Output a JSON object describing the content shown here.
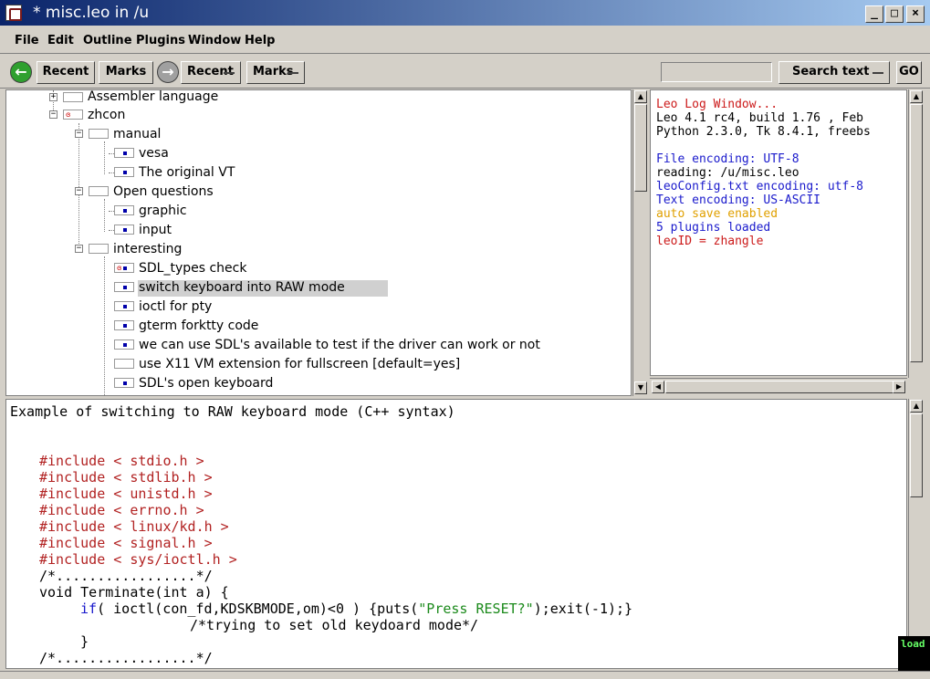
{
  "window": {
    "title": "* misc.leo in /u"
  },
  "menu": [
    "File",
    "Edit",
    "Outline",
    "Plugins",
    "Window",
    "Help"
  ],
  "toolbar": {
    "recent": "Recent",
    "marks": "Marks",
    "recent_menu": "Recent",
    "marks_menu": "Marks",
    "search_value": "",
    "search_text": "Search text",
    "go": "GO"
  },
  "outline": [
    {
      "label": "Assembler language"
    },
    {
      "label": "zhcon"
    },
    {
      "label": "manual"
    },
    {
      "label": "vesa"
    },
    {
      "label": "The original VT"
    },
    {
      "label": "Open questions"
    },
    {
      "label": "graphic"
    },
    {
      "label": "input"
    },
    {
      "label": "interesting"
    },
    {
      "label": "SDL_types check"
    },
    {
      "label": "switch keyboard into RAW mode"
    },
    {
      "label": "ioctl for pty"
    },
    {
      "label": "gterm forktty code"
    },
    {
      "label": "we can use SDL's available to test if the driver can work or not"
    },
    {
      "label": "use X11 VM extension for fullscreen [default=yes]"
    },
    {
      "label": "SDL's open keyboard"
    }
  ],
  "log": [
    {
      "text": "Leo Log Window...",
      "color": "#cc1a1a"
    },
    {
      "text": "Leo 4.1 rc4, build  1.76 , Feb",
      "color": "#000000"
    },
    {
      "text": "Python 2.3.0, Tk 8.4.1, freebs",
      "color": "#000000"
    },
    {
      "text": "",
      "color": "#000000"
    },
    {
      "text": "File encoding: UTF-8",
      "color": "#1a1acc"
    },
    {
      "text": "reading: /u/misc.leo",
      "color": "#000000"
    },
    {
      "text": "leoConfig.txt encoding: utf-8",
      "color": "#1a1acc"
    },
    {
      "text": "Text encoding: US-ASCII",
      "color": "#1a1acc"
    },
    {
      "text": "auto save enabled",
      "color": "#e0a000"
    },
    {
      "text": "5 plugins loaded",
      "color": "#1a1acc"
    },
    {
      "text": "leoID = zhangle",
      "color": "#cc1a1a"
    }
  ],
  "body": {
    "heading": "Example of switching to RAW keyboard mode (C++ syntax)",
    "includes": [
      "#include < stdio.h >",
      "#include < stdlib.h >",
      "#include < unistd.h >",
      "#include < errno.h >",
      "#include < linux/kd.h >",
      "#include < signal.h >",
      "#include < sys/ioctl.h >"
    ],
    "comment1": "/*.................*/",
    "func": "void Terminate(int a) {",
    "if_kw": "if",
    "if_rest1": "( ioctl(con_fd,KDSKBMODE,om)<0 ) {puts(",
    "if_str": "\"Press RESET?\"",
    "if_rest2": ");exit(-1);}",
    "comment2": "/*trying to set old keydoard mode*/",
    "close": "}",
    "comment3": "/*.................*/"
  },
  "status": {
    "load": "load"
  }
}
